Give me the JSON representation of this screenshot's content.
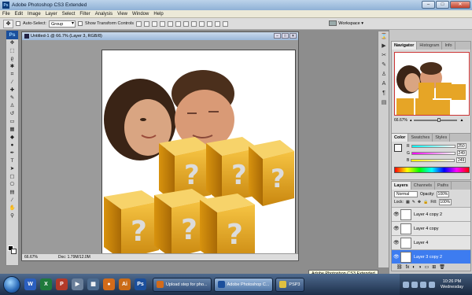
{
  "window": {
    "title": "Adobe Photoshop CS3 Extended",
    "app_icon": "Ps",
    "minimize": "–",
    "maximize": "□",
    "close": "✕"
  },
  "menu": [
    "File",
    "Edit",
    "Image",
    "Layer",
    "Select",
    "Filter",
    "Analysis",
    "View",
    "Window",
    "Help"
  ],
  "options": {
    "auto_select_label": "Auto-Select:",
    "auto_select_value": "Group",
    "show_transform_label": "Show Transform Controls",
    "workspace_label": "Workspace ▾"
  },
  "document": {
    "title": "Untitled-1 @ 66.7% (Layer 3, RGB/8)",
    "zoom": "66.67%",
    "doc_size": "Doc: 1.79M/12.0M"
  },
  "navigator": {
    "tabs": [
      "Navigator",
      "Histogram",
      "Info"
    ],
    "zoom": "66.67%"
  },
  "color_panel": {
    "tabs": [
      "Color",
      "Swatches",
      "Styles"
    ],
    "rows": [
      {
        "label": "R",
        "value": "250",
        "color": "#e0a020"
      },
      {
        "label": "G",
        "value": "249",
        "color": "#20c0a0"
      },
      {
        "label": "B",
        "value": "249",
        "color": "#c040d0"
      }
    ],
    "fg_color": "#faf9f9"
  },
  "layers_panel": {
    "tabs": [
      "Layers",
      "Channels",
      "Paths"
    ],
    "blend_mode": "Normal",
    "opacity_label": "Opacity:",
    "opacity_value": "100%",
    "lock_label": "Lock:",
    "fill_label": "Fill:",
    "fill_value": "100%",
    "layers": [
      {
        "name": "Layer 4 copy 2",
        "visible": true,
        "selected": false
      },
      {
        "name": "Layer 4 copy",
        "visible": true,
        "selected": false
      },
      {
        "name": "Layer 4",
        "visible": true,
        "selected": false
      },
      {
        "name": "Layer 3 copy 2",
        "visible": true,
        "selected": true
      }
    ]
  },
  "tooltip": "Adobe Photoshop CS3 Extended",
  "taskbar": {
    "tasks": [
      {
        "label": "Upload step for pho...",
        "active": false
      },
      {
        "label": "Adobe Photoshop C...",
        "active": true
      },
      {
        "label": "PSP3",
        "active": false
      }
    ],
    "time": "10:26 PM",
    "day": "Wednesday"
  }
}
